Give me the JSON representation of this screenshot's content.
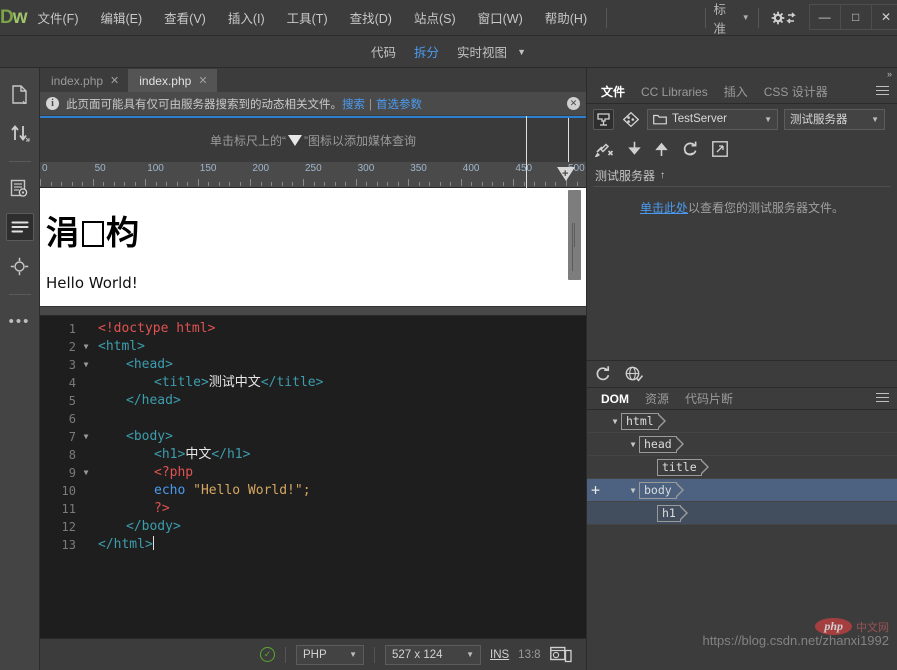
{
  "app": {
    "logo": "Dw",
    "menus": [
      {
        "label": "文件(F)",
        "name": "menu-file"
      },
      {
        "label": "编辑(E)",
        "name": "menu-edit"
      },
      {
        "label": "查看(V)",
        "name": "menu-view"
      },
      {
        "label": "插入(I)",
        "name": "menu-insert"
      },
      {
        "label": "工具(T)",
        "name": "menu-tools"
      },
      {
        "label": "查找(D)",
        "name": "menu-find"
      },
      {
        "label": "站点(S)",
        "name": "menu-site"
      },
      {
        "label": "窗口(W)",
        "name": "menu-window"
      },
      {
        "label": "帮助(H)",
        "name": "menu-help"
      }
    ],
    "workspace": "标准",
    "window_controls": {
      "minimize": "—",
      "maximize": "□",
      "close": "✕"
    }
  },
  "viewbar": {
    "code": "代码",
    "split": "拆分",
    "live": "实时视图",
    "active": "拆分"
  },
  "left_toolbar": {
    "items": [
      {
        "name": "file-management-icon"
      },
      {
        "name": "transfer-icon"
      },
      {
        "name": "code-inspect-icon"
      },
      {
        "name": "format-source-icon"
      },
      {
        "name": "target-icon"
      },
      {
        "name": "more-options-icon"
      }
    ],
    "more_label": "•••"
  },
  "tabs": [
    {
      "label": "index.php",
      "close": "✕",
      "active": false
    },
    {
      "label": "index.php",
      "close": "✕",
      "active": true
    }
  ],
  "info_bar": {
    "message": "此页面可能具有仅可由服务器搜索到的动态相关文件。",
    "link_search": "搜索",
    "separator": "|",
    "link_prefs": "首选参数",
    "close": "✕"
  },
  "media_query_bar": {
    "text_before": "单击标尺上的“",
    "text_after": "”图标以添加媒体查询"
  },
  "ruler": {
    "numbers": [
      "0",
      "50",
      "100",
      "150",
      "200",
      "250",
      "300",
      "350",
      "400",
      "450",
      "500"
    ],
    "handle_label": "+"
  },
  "preview": {
    "heading_left": "涓",
    "heading_right": "枃",
    "paragraph": "Hello World!"
  },
  "code": {
    "lines": [
      {
        "num": "1",
        "fold": "",
        "indent": 0,
        "tokens": [
          {
            "t": "<!doctype html>",
            "c": "tk-doctype"
          }
        ]
      },
      {
        "num": "2",
        "fold": "▼",
        "indent": 0,
        "tokens": [
          {
            "t": "<html>",
            "c": "tk-tag"
          }
        ]
      },
      {
        "num": "3",
        "fold": "▼",
        "indent": 1,
        "tokens": [
          {
            "t": "<head>",
            "c": "tk-tag"
          }
        ]
      },
      {
        "num": "4",
        "fold": "",
        "indent": 2,
        "tokens": [
          {
            "t": "<title>",
            "c": "tk-tag"
          },
          {
            "t": "测试中文",
            "c": "tk-text"
          },
          {
            "t": "</title>",
            "c": "tk-tag"
          }
        ]
      },
      {
        "num": "5",
        "fold": "",
        "indent": 1,
        "tokens": [
          {
            "t": "</head>",
            "c": "tk-tag"
          }
        ]
      },
      {
        "num": "6",
        "fold": "",
        "indent": 0,
        "tokens": []
      },
      {
        "num": "7",
        "fold": "▼",
        "indent": 1,
        "tokens": [
          {
            "t": "<body>",
            "c": "tk-tag"
          }
        ]
      },
      {
        "num": "8",
        "fold": "",
        "indent": 2,
        "tokens": [
          {
            "t": "<h1>",
            "c": "tk-tag"
          },
          {
            "t": "中文",
            "c": "tk-text"
          },
          {
            "t": "</h1>",
            "c": "tk-tag"
          }
        ]
      },
      {
        "num": "9",
        "fold": "▼",
        "indent": 2,
        "tokens": [
          {
            "t": "<?php",
            "c": "tk-php"
          }
        ]
      },
      {
        "num": "10",
        "fold": "",
        "indent": 2,
        "tokens": [
          {
            "t": "echo",
            "c": "tk-kw"
          },
          {
            "t": " ",
            "c": "ctext"
          },
          {
            "t": "\"Hello World!\"",
            "c": "tk-str"
          },
          {
            "t": ";",
            "c": "tk-str"
          }
        ]
      },
      {
        "num": "11",
        "fold": "",
        "indent": 2,
        "tokens": [
          {
            "t": "?>",
            "c": "tk-php"
          }
        ]
      },
      {
        "num": "12",
        "fold": "",
        "indent": 1,
        "tokens": [
          {
            "t": "</body>",
            "c": "tk-tag"
          }
        ]
      },
      {
        "num": "13",
        "fold": "",
        "indent": 0,
        "tokens": [
          {
            "t": "</html>",
            "c": "tk-tag"
          }
        ]
      }
    ]
  },
  "statusbar": {
    "validation": "✓",
    "doctype": "PHP",
    "dimensions": "527 x 124",
    "insert_mode": "INS",
    "cursor": "13:8"
  },
  "right_panel": {
    "collapse": "»",
    "tabs": [
      {
        "label": "文件",
        "active": true,
        "name": "panel-tab-files"
      },
      {
        "label": "CC Libraries",
        "active": false,
        "name": "panel-tab-cc-libraries"
      },
      {
        "label": "插入",
        "active": false,
        "name": "panel-tab-insert"
      },
      {
        "label": "CSS 设计器",
        "active": false,
        "name": "panel-tab-css-designer"
      }
    ],
    "site_select": "TestServer",
    "view_select": "测试服务器",
    "server_label": "测试服务器",
    "server_arrow": "↑",
    "empty_link": "单击此处",
    "empty_rest": "以查看您的测试服务器文件。"
  },
  "dom_panel": {
    "tabs": [
      {
        "label": "DOM",
        "active": true,
        "name": "dom-tab-dom"
      },
      {
        "label": "资源",
        "active": false,
        "name": "dom-tab-assets"
      },
      {
        "label": "代码片断",
        "active": false,
        "name": "dom-tab-snippets"
      }
    ],
    "tree": [
      {
        "tag": "html",
        "depth": 1,
        "chevron": "⌄",
        "selected": false,
        "plus": ""
      },
      {
        "tag": "head",
        "depth": 2,
        "chevron": "⌄",
        "selected": false,
        "plus": ""
      },
      {
        "tag": "title",
        "depth": 3,
        "chevron": "",
        "selected": false,
        "plus": ""
      },
      {
        "tag": "body",
        "depth": 2,
        "chevron": "⌄",
        "selected": true,
        "plus": "+"
      },
      {
        "tag": "h1",
        "depth": 3,
        "chevron": "",
        "selected": false,
        "plus": "",
        "child_selected": true
      }
    ]
  },
  "watermark": {
    "logo": "php",
    "logo_cn": "中文网",
    "url": "https://blog.csdn.net/zhanxi1992"
  },
  "colors": {
    "accent_blue": "#4a9bf0",
    "chrome_bg": "#3c3c3c",
    "code_bg": "#1e1e1e",
    "selection_blue": "#4c6280",
    "logo_green": "#7aa34a"
  }
}
